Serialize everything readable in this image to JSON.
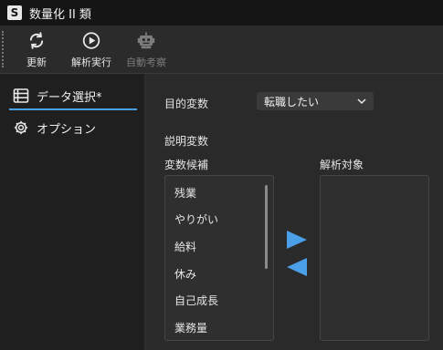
{
  "titlebar": {
    "logo": "S",
    "title": "数量化 II 類"
  },
  "toolbar": {
    "refresh_label": "更新",
    "run_label": "解析実行",
    "auto_label": "自動考察"
  },
  "sidebar": {
    "items": [
      {
        "label": "データ選択*",
        "icon": "table-list-icon",
        "active": true
      },
      {
        "label": "オプション",
        "icon": "gear-icon",
        "active": false
      }
    ]
  },
  "main": {
    "objective_label": "目的変数",
    "objective_value": "転職したい",
    "explanatory_label": "説明変数",
    "candidates_label": "変数候補",
    "targets_label": "解析対象",
    "candidates": [
      "残業",
      "やりがい",
      "給料",
      "休み",
      "自己成長",
      "業務量"
    ],
    "targets": []
  },
  "colors": {
    "accent": "#4a9fe8",
    "background": "#1e1e1e",
    "panel": "#2a2a2a"
  }
}
